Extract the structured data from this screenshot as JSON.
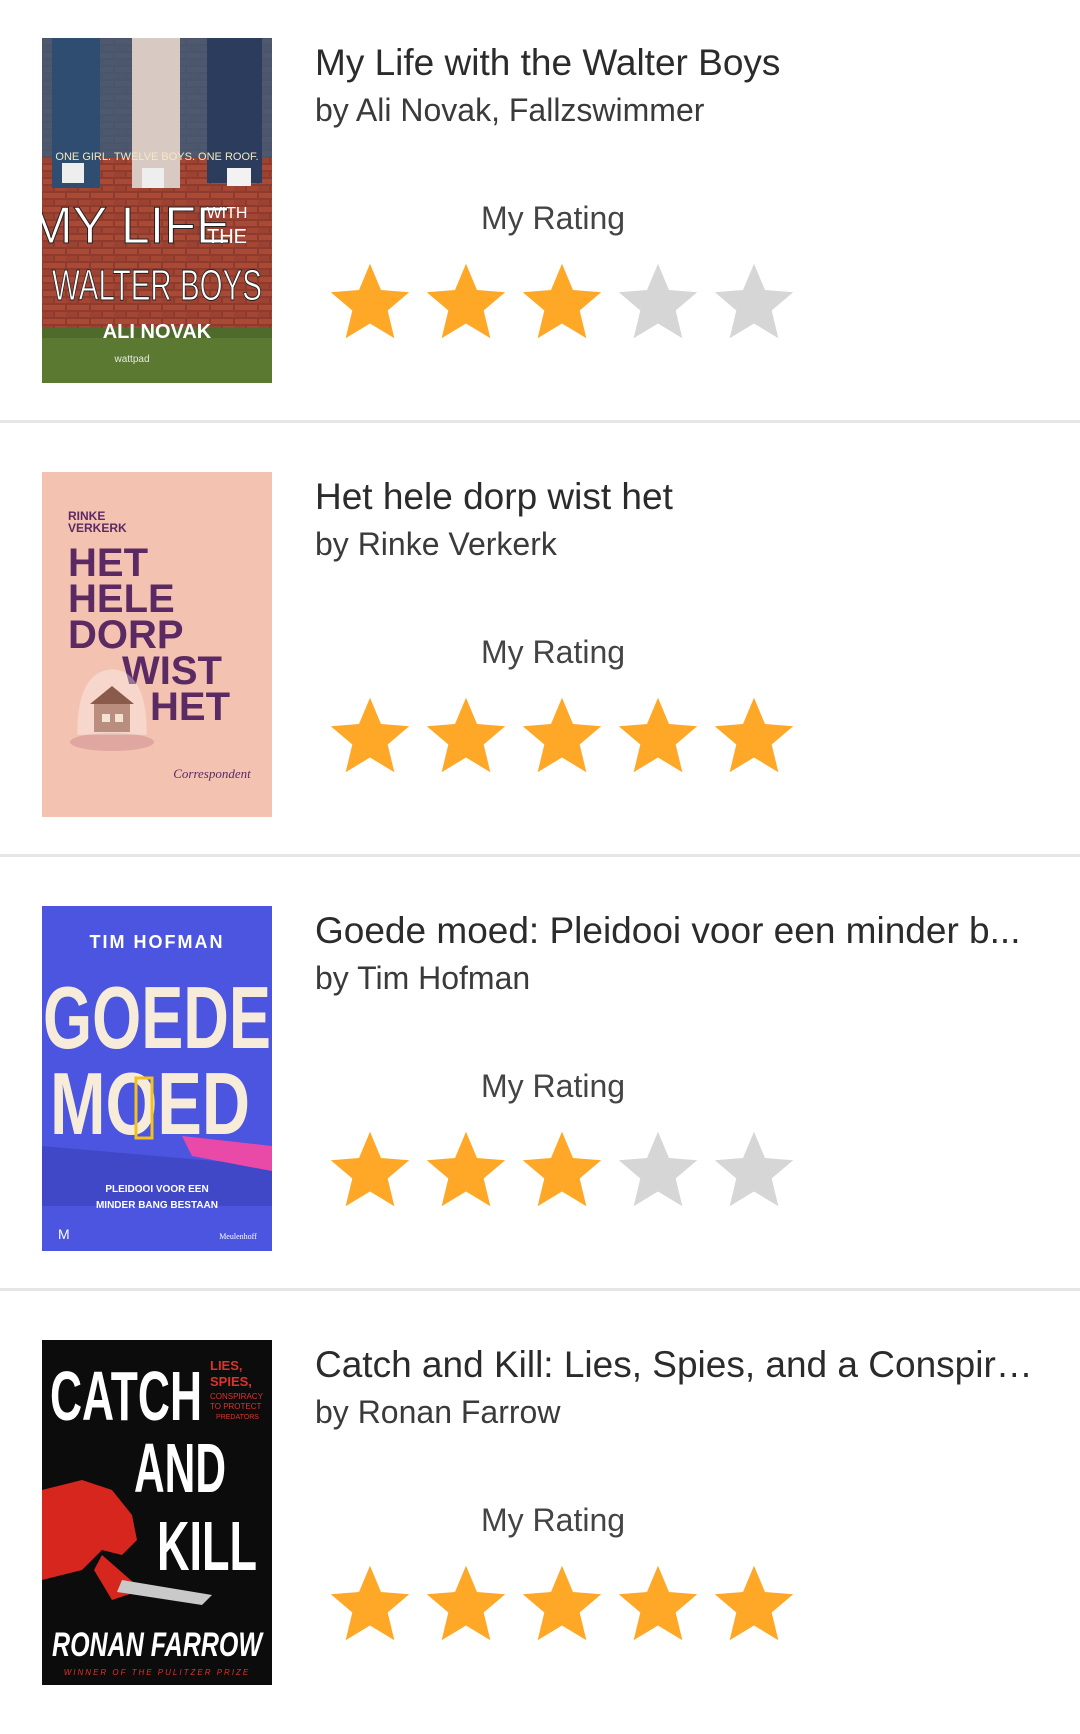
{
  "colors": {
    "star_filled": "#FFA726",
    "star_empty": "#D6D6D6",
    "divider": "#E6E6E6"
  },
  "rating_label": "My Rating",
  "books": [
    {
      "title": "My Life with the Walter Boys",
      "author": "by Ali Novak, Fallzswimmer",
      "rating": 3,
      "max_rating": 5,
      "cover": {
        "tagline": "ONE GIRL. TWELVE BOYS. ONE ROOF.",
        "title_line1": "MY LIFE",
        "title_with": "WITH",
        "title_the": "THE",
        "title_line2": "WALTER BOYS",
        "author": "ALI NOVAK",
        "publisher": "wattpad"
      }
    },
    {
      "title": "Het hele dorp wist het",
      "author": "by Rinke Verkerk",
      "rating": 5,
      "max_rating": 5,
      "cover": {
        "author_line1": "RINKE",
        "author_line2": "VERKERK",
        "word1": "HET",
        "word2": "HELE",
        "word3": "DORP",
        "word4": "WIST",
        "word5": "HET",
        "publisher": "Correspondent"
      }
    },
    {
      "title": "Goede moed: Pleidooi voor een minder b...",
      "author": "by Tim Hofman",
      "rating": 3,
      "max_rating": 5,
      "cover": {
        "author": "TIM HOFMAN",
        "word1": "GOEDE",
        "word2": "MOED",
        "subtitle1": "PLEIDOOI VOOR EEN",
        "subtitle2": "MINDER BANG BESTAAN",
        "publisher_mark": "M",
        "publisher": "Meulenhoff"
      }
    },
    {
      "title": "Catch and Kill: Lies, Spies, and a Conspira...",
      "author": "by Ronan Farrow",
      "rating": 5,
      "max_rating": 5,
      "cover": {
        "word1": "CATCH",
        "word2": "AND",
        "word3": "KILL",
        "side1": "LIES,",
        "side2": "SPIES,",
        "side3": "CONSPIRACY",
        "side4": "TO PROTECT",
        "side5": "PREDATORS",
        "author": "RONAN FARROW",
        "award": "WINNER OF THE PULITZER PRIZE"
      }
    }
  ]
}
